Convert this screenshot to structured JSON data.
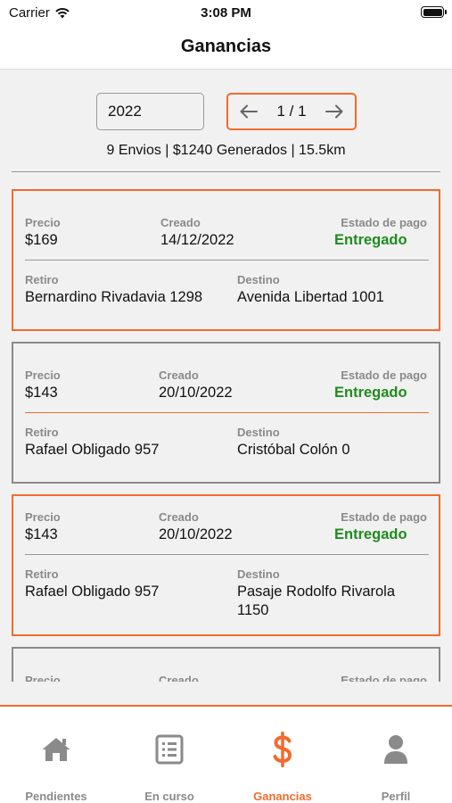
{
  "status_bar": {
    "carrier": "Carrier",
    "time": "3:08 PM"
  },
  "header": {
    "title": "Ganancias"
  },
  "filters": {
    "year": "2022",
    "page_indicator": "1 / 1"
  },
  "summary": "9 Envios | $1240 Generados | 15.5km",
  "labels": {
    "price": "Precio",
    "created": "Creado",
    "payment_status": "Estado de pago",
    "pickup": "Retiro",
    "destination": "Destino"
  },
  "deliveries": [
    {
      "price": "$169",
      "created": "14/12/2022",
      "payment_status": "Entregado",
      "pickup": "Bernardino Rivadavia 1298",
      "destination": "Avenida Libertad 1001"
    },
    {
      "price": "$143",
      "created": "20/10/2022",
      "payment_status": "Entregado",
      "pickup": "Rafael Obligado 957",
      "destination": "Cristóbal Colón 0"
    },
    {
      "price": "$143",
      "created": "20/10/2022",
      "payment_status": "Entregado",
      "pickup": "Rafael Obligado 957",
      "destination": "Pasaje Rodolfo Rivarola 1150"
    },
    {
      "price": "",
      "created": "",
      "payment_status": "",
      "pickup": "",
      "destination": ""
    }
  ],
  "tabs": [
    {
      "label": "Pendientes",
      "icon": "home-icon",
      "active": false
    },
    {
      "label": "En curso",
      "icon": "list-icon",
      "active": false
    },
    {
      "label": "Ganancias",
      "icon": "dollar-icon",
      "active": true
    },
    {
      "label": "Perfil",
      "icon": "user-icon",
      "active": false
    }
  ],
  "colors": {
    "accent": "#f26b2d",
    "paid": "#1e8c1e",
    "muted": "#8a8a8a"
  }
}
